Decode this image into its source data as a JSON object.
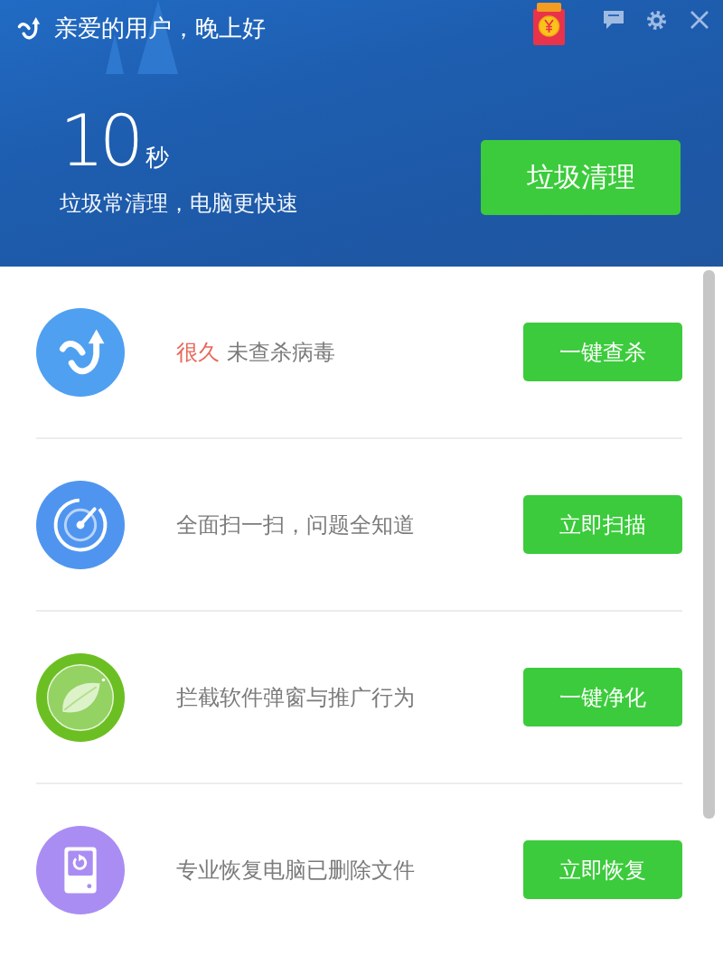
{
  "header": {
    "greeting": "亲爱的用户，晚上好",
    "timer": {
      "value": "10",
      "unit": "秒"
    },
    "tagline": "垃圾常清理，电脑更快速",
    "action": "垃圾清理"
  },
  "tasks": [
    {
      "kind": "virus",
      "highlight": "很久",
      "description": "未查杀病毒",
      "action": "一键查杀"
    },
    {
      "kind": "scan",
      "description": "全面扫一扫，问题全知道",
      "action": "立即扫描"
    },
    {
      "kind": "popup",
      "description": "拦截软件弹窗与推广行为",
      "action": "一键净化"
    },
    {
      "kind": "recover",
      "description": "专业恢复电脑已删除文件",
      "action": "立即恢复"
    }
  ]
}
